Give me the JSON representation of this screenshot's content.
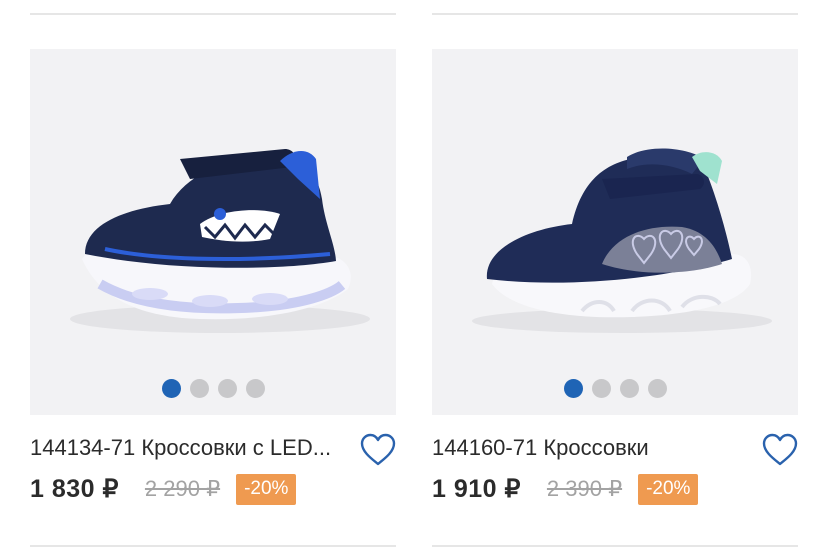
{
  "products": [
    {
      "title": "144134-71 Кроссовки с LED...",
      "price": "1 830 ₽",
      "old_price": "2 290 ₽",
      "discount": "-20%"
    },
    {
      "title": "144160-71 Кроссовки",
      "price": "1 910 ₽",
      "old_price": "2 390 ₽",
      "discount": "-20%"
    }
  ],
  "gallery": {
    "total_slides": 4,
    "active_slide": 1
  },
  "colors": {
    "accent": "#1f64b5",
    "badge": "#ef9a50",
    "favorite_icon": "#2a62ad",
    "old_price": "#a3a3a3"
  },
  "icons": {
    "favorite": "heart-outline-icon"
  }
}
